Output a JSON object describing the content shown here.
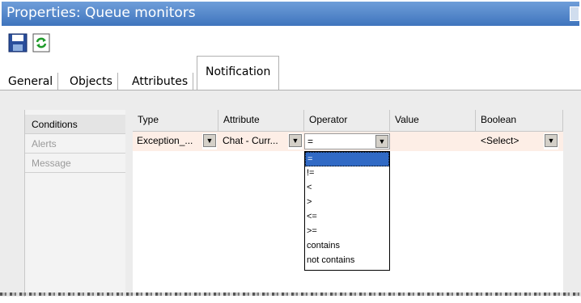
{
  "window": {
    "title": "Properties: Queue monitors"
  },
  "toolbar": {
    "save_icon": "save-icon",
    "refresh_icon": "refresh-icon"
  },
  "tabs": [
    {
      "label": "General",
      "active": false
    },
    {
      "label": "Objects",
      "active": false
    },
    {
      "label": "Attributes",
      "active": false
    },
    {
      "label": "Notification",
      "active": true
    }
  ],
  "nav": {
    "items": [
      {
        "label": "Conditions",
        "active": true
      },
      {
        "label": "Alerts",
        "active": false
      },
      {
        "label": "Message",
        "active": false
      }
    ]
  },
  "grid": {
    "headers": [
      "Type",
      "Attribute",
      "Operator",
      "Value",
      "Boolean"
    ],
    "row": {
      "type": "Exception_...",
      "attribute": "Chat - Curr...",
      "operator": "=",
      "value": "",
      "boolean": "<Select>"
    }
  },
  "operator_dropdown": {
    "options": [
      "=",
      "!=",
      "<",
      ">",
      "<=",
      ">=",
      "contains",
      "not contains"
    ],
    "selected": "="
  },
  "colors": {
    "title_bar": "#4a80c8",
    "row_highlight": "#fdeee6",
    "selection": "#316ac5"
  }
}
